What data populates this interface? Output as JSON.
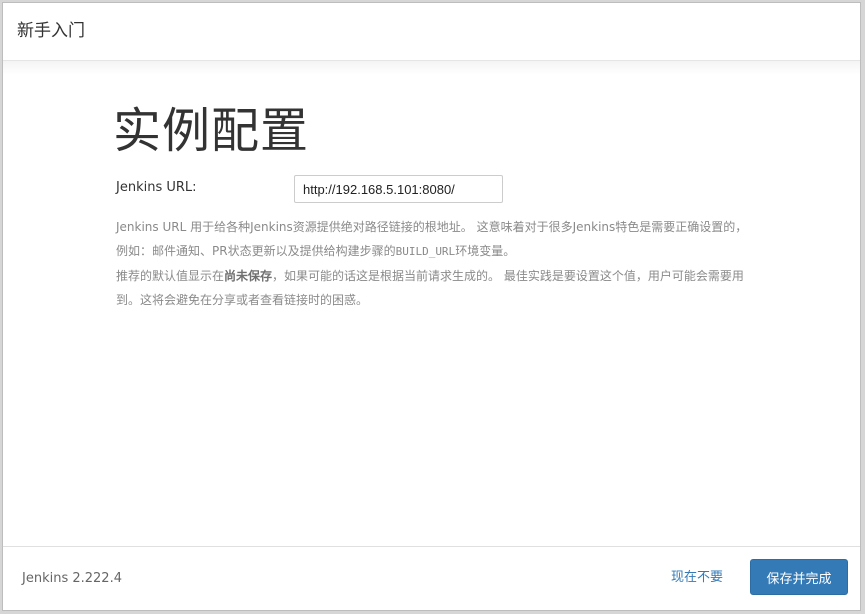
{
  "header": {
    "title": "新手入门"
  },
  "main": {
    "heading": "实例配置",
    "url_label": "Jenkins URL:",
    "url_value": "http://192.168.5.101:8080/",
    "help": {
      "line1_a": "Jenkins URL 用于给各种Jenkins资源提供绝对路径链接的根地址。 这意味着对于很多Jenkins特色是需要正确设置的，例如：邮件通知、PR状态更新以及提供给构建步骤的",
      "line1_code": "BUILD_URL",
      "line1_b": "环境变量。",
      "line2_a": "推荐的默认值显示在",
      "line2_strong": "尚未保存",
      "line2_b": "，如果可能的话这是根据当前请求生成的。 最佳实践是要设置这个值，用户可能会需要用到。这将会避免在分享或者查看链接时的困惑。"
    }
  },
  "footer": {
    "version": "Jenkins 2.222.4",
    "skip_label": "现在不要",
    "save_label": "保存并完成"
  },
  "colors": {
    "primary": "#337ab7",
    "help_text": "#8a8a8a"
  }
}
